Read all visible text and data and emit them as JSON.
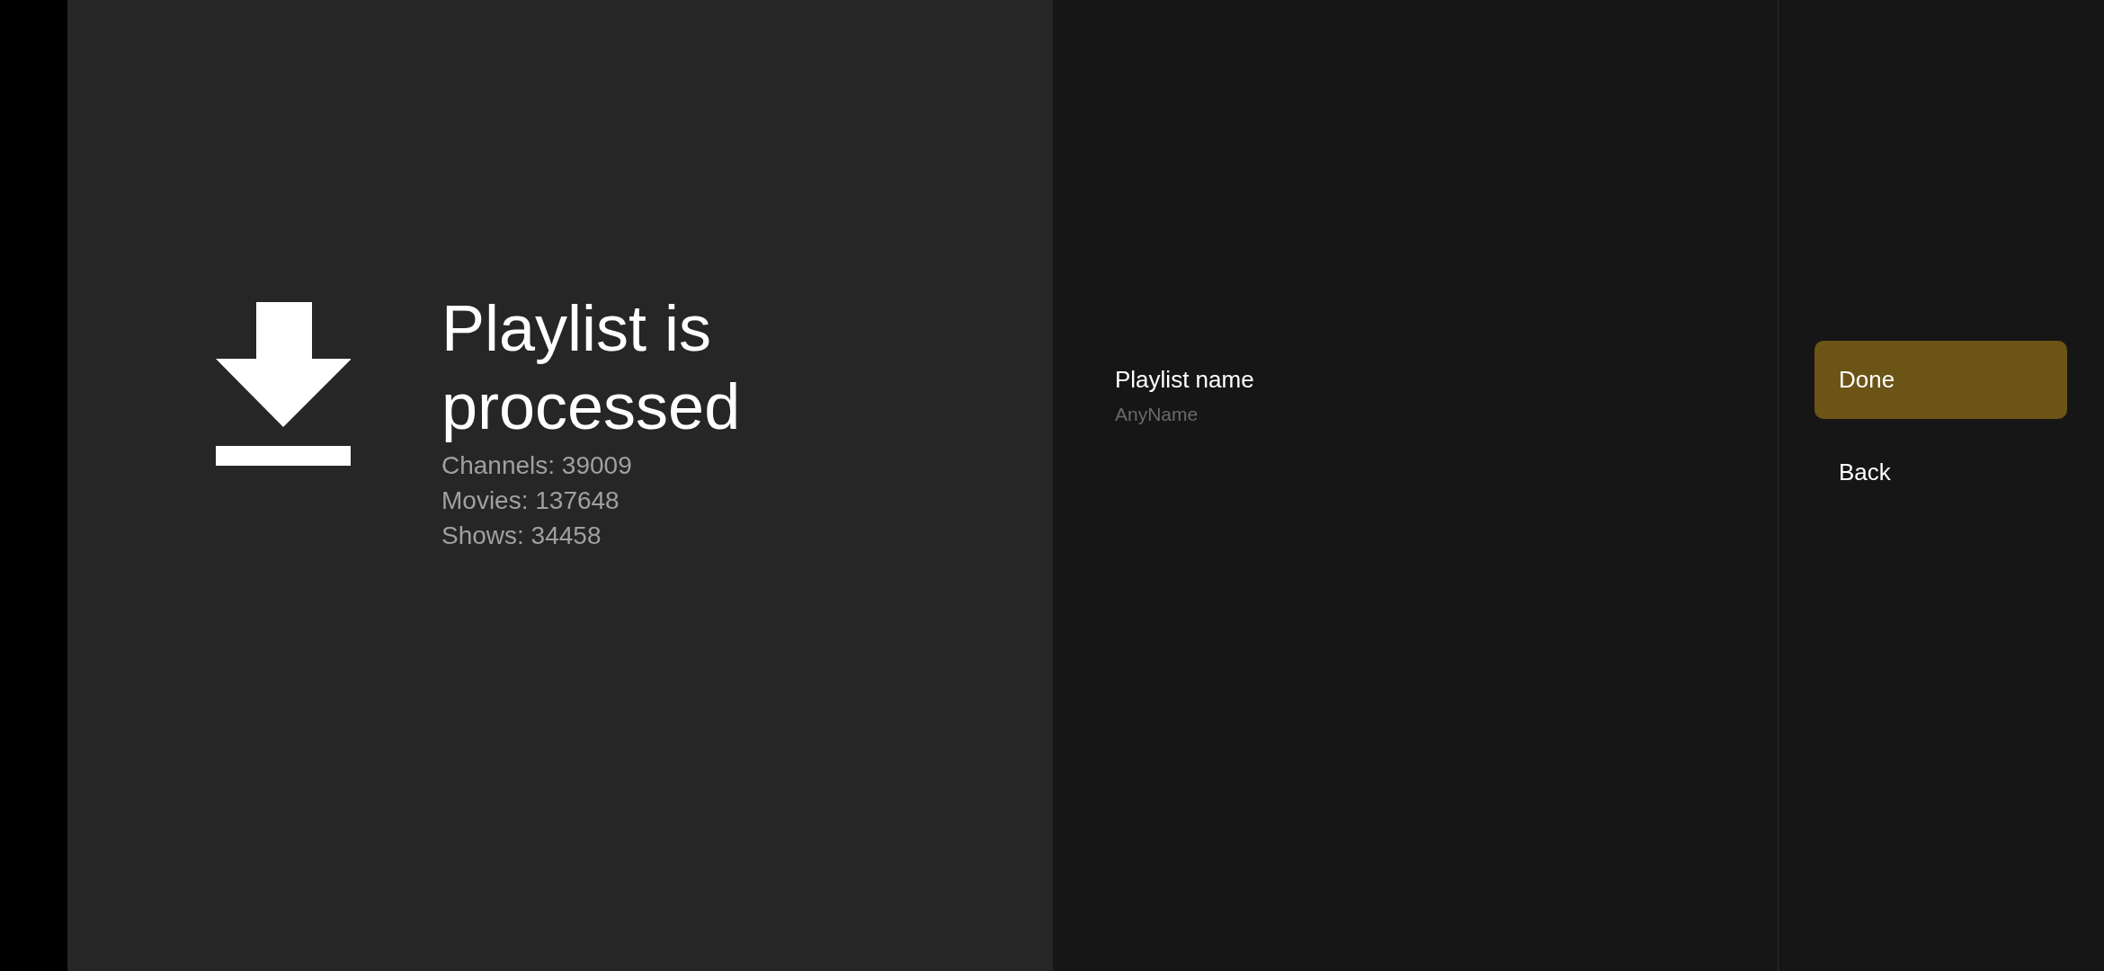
{
  "summary": {
    "title": "Playlist is processed",
    "stats": [
      "Channels: 39009",
      "Movies: 137648",
      "Shows: 34458"
    ]
  },
  "field": {
    "label": "Playlist name",
    "placeholder": "AnyName"
  },
  "actions": [
    {
      "label": "Done",
      "selected": true
    },
    {
      "label": "Back",
      "selected": false
    }
  ]
}
